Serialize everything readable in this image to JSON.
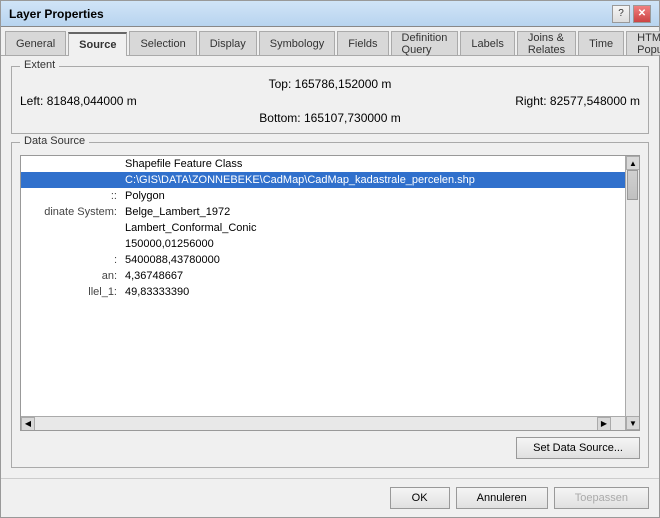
{
  "window": {
    "title": "Layer Properties"
  },
  "tabs": [
    {
      "label": "General",
      "active": false
    },
    {
      "label": "Source",
      "active": true
    },
    {
      "label": "Selection",
      "active": false
    },
    {
      "label": "Display",
      "active": false
    },
    {
      "label": "Symbology",
      "active": false
    },
    {
      "label": "Fields",
      "active": false
    },
    {
      "label": "Definition Query",
      "active": false
    },
    {
      "label": "Labels",
      "active": false
    },
    {
      "label": "Joins & Relates",
      "active": false
    },
    {
      "label": "Time",
      "active": false
    },
    {
      "label": "HTML Popup",
      "active": false
    }
  ],
  "extent": {
    "label": "Extent",
    "top_label": "Top:",
    "top_value": "165786,152000 m",
    "left_label": "Left:",
    "left_value": "81848,044000 m",
    "right_label": "Right:",
    "right_value": "82577,548000 m",
    "bottom_label": "Bottom:",
    "bottom_value": "165107,730000 m"
  },
  "datasource": {
    "label": "Data Source",
    "rows": [
      {
        "key": "",
        "value": "Shapefile Feature Class",
        "highlight": false
      },
      {
        "key": "",
        "value": "C:\\GIS\\DATA\\ZONNEBEKE\\CadMap\\CadMap_kadastrale_percelen.shp",
        "highlight": true
      },
      {
        "key": "::",
        "value": "Polygon",
        "highlight": false
      },
      {
        "key": "dinate System:",
        "value": "Belge_Lambert_1972",
        "highlight": false
      },
      {
        "key": "",
        "value": "Lambert_Conformal_Conic",
        "highlight": false
      },
      {
        "key": "",
        "value": "150000,01256000",
        "highlight": false
      },
      {
        "key": ":",
        "value": "5400088,43780000",
        "highlight": false
      },
      {
        "key": "an:",
        "value": "4,36748667",
        "highlight": false
      },
      {
        "key": "llel_1:",
        "value": "49,83333390",
        "highlight": false
      }
    ],
    "set_btn": "Set Data Source..."
  },
  "footer": {
    "ok": "OK",
    "cancel": "Annuleren",
    "apply": "Toepassen"
  }
}
